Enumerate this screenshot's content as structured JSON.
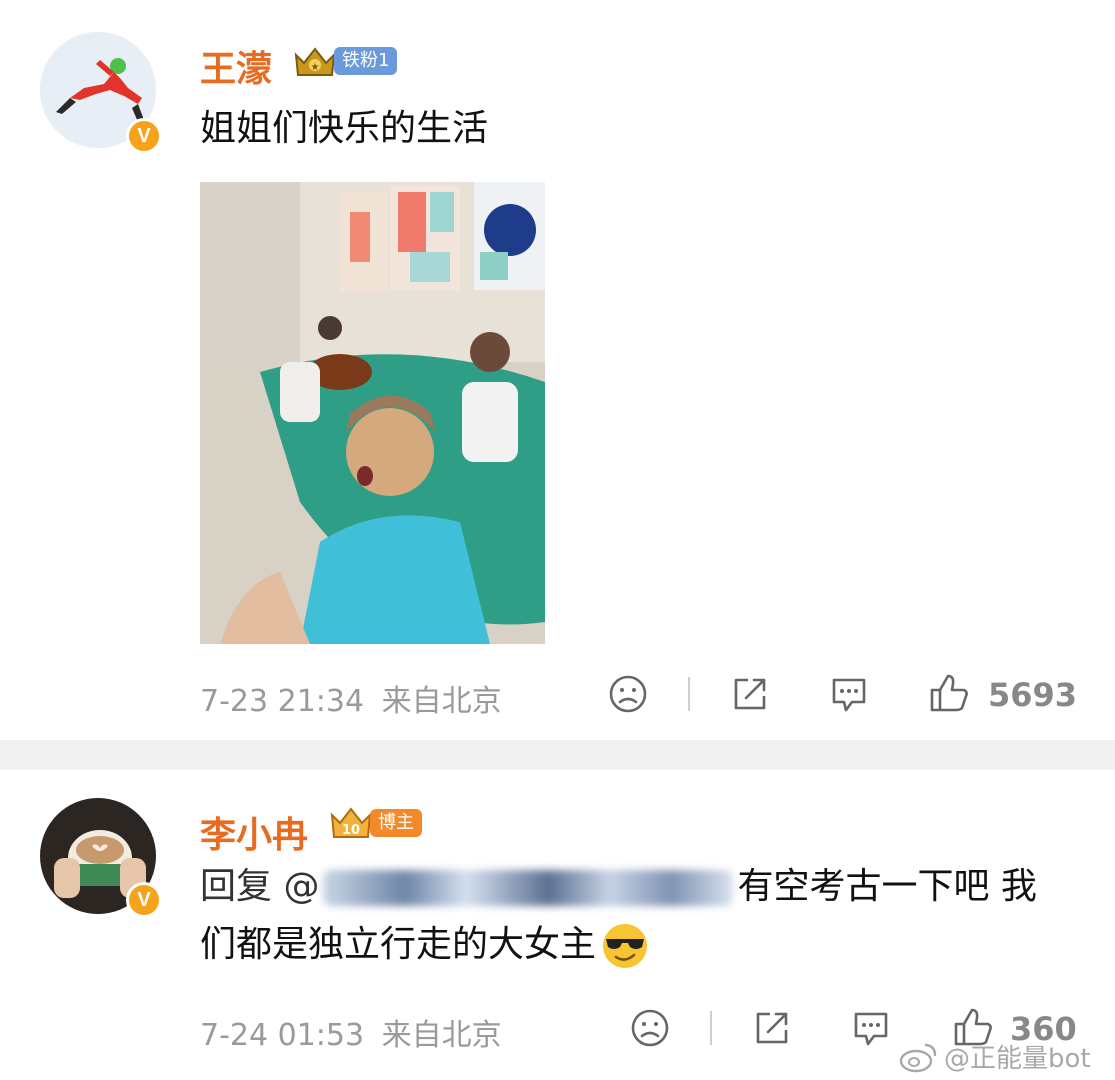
{
  "comments": [
    {
      "username": "王濛",
      "badge_label": "铁粉1",
      "text": "姐姐们快乐的生活",
      "time": "7-23 21:34",
      "location": "来自北京",
      "likes": "5693"
    },
    {
      "username": "李小冉",
      "badge_label": "博主",
      "crown_level": "10",
      "reply_prefix": "回复 @",
      "text_part1": "有空考古一下吧 我",
      "text_part2": "们都是独立行走的大女主",
      "time": "7-24 01:53",
      "location": "来自北京",
      "likes": "360"
    }
  ],
  "watermark": "@正能量bot",
  "icons": [
    "verified-v-icon",
    "crown-icon",
    "sad-face-icon",
    "share-icon",
    "comment-icon",
    "like-icon",
    "cool-emoji-icon",
    "weibo-logo-icon"
  ],
  "colors": {
    "username": "#e86b22",
    "fan_badge": "#6a9ad9",
    "blogger_badge": "#f28a2a",
    "meta": "#9a9a9a"
  }
}
